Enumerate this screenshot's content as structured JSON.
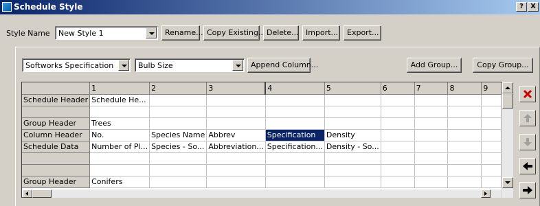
{
  "window": {
    "title": "Schedule Style",
    "help_label": "?",
    "close_label": "X"
  },
  "style_row": {
    "label": "Style Name",
    "value": "New Style 1",
    "buttons": [
      "Rename...",
      "Copy Existing...",
      "Delete...",
      "Import...",
      "Export..."
    ]
  },
  "toolbar": {
    "spec_select": "Softworks Specification",
    "field_select": "Bulb Size",
    "append_label": "Append Column...",
    "add_group_label": "Add Group...",
    "copy_group_label": "Copy Group..."
  },
  "grid": {
    "column_numbers": [
      "1",
      "2",
      "3",
      "4",
      "5",
      "6",
      "7",
      "8",
      "9"
    ],
    "selected": {
      "row": 3,
      "col": 3
    },
    "rows": [
      {
        "header": "Schedule Header",
        "cells": [
          "Schedule He...",
          "",
          "",
          "",
          "",
          "",
          "",
          "",
          ""
        ]
      },
      {
        "header": "",
        "cells": [
          "",
          "",
          "",
          "",
          "",
          "",
          "",
          "",
          ""
        ]
      },
      {
        "header": "Group Header",
        "cells": [
          "Trees",
          "",
          "",
          "",
          "",
          "",
          "",
          "",
          ""
        ]
      },
      {
        "header": "Column Header",
        "cells": [
          "No.",
          "Species Name",
          "Abbrev",
          "Specification",
          "Density",
          "",
          "",
          "",
          ""
        ]
      },
      {
        "header": "Schedule Data",
        "cells": [
          "Number of Pl...",
          "Species - So...",
          "Abbreviation...",
          "Specification...",
          "Density - So...",
          "",
          "",
          "",
          ""
        ]
      },
      {
        "header": "",
        "cells": [
          "",
          "",
          "",
          "",
          "",
          "",
          "",
          "",
          ""
        ]
      },
      {
        "header": "",
        "cells": [
          "",
          "",
          "",
          "",
          "",
          "",
          "",
          "",
          ""
        ]
      },
      {
        "header": "Group Header",
        "cells": [
          "Conifers",
          "",
          "",
          "",
          "",
          "",
          "",
          "",
          ""
        ]
      }
    ]
  },
  "side_buttons": [
    "delete-icon",
    "move-up-icon",
    "move-down-icon",
    "move-left-icon",
    "move-right-icon"
  ],
  "colors": {
    "titlebar_start": "#0a246a",
    "titlebar_end": "#a6caf0",
    "selection": "#0a246a",
    "delete_red": "#cc0000",
    "face": "#d4d0c8"
  }
}
